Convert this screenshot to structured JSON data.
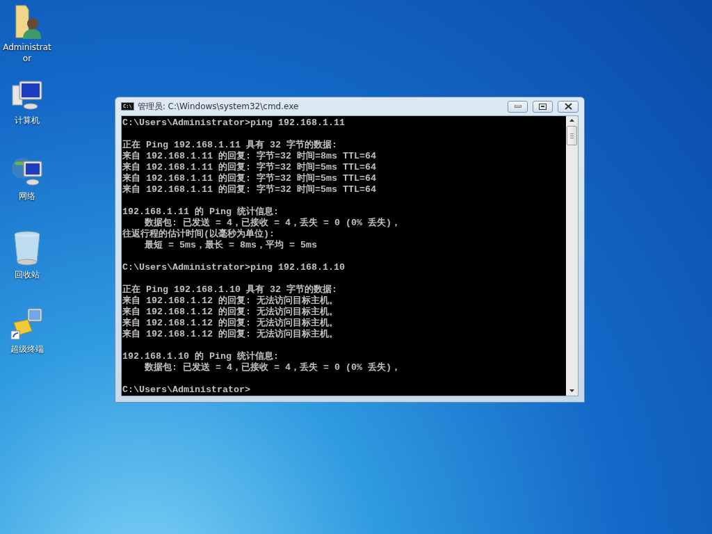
{
  "desktop_icons": [
    {
      "kind": "user-folder",
      "label": "Administrator"
    },
    {
      "kind": "computer",
      "label": "计算机"
    },
    {
      "kind": "network",
      "label": "网络"
    },
    {
      "kind": "recycle-bin",
      "label": "回收站"
    },
    {
      "kind": "terminal-shortcut",
      "label": "超级终端"
    }
  ],
  "window": {
    "title": "管理员: C:\\Windows\\system32\\cmd.exe",
    "icon_text": "C:\\",
    "console_blocks": [
      {
        "lines": [
          "C:\\Users\\Administrator>ping 192.168.1.11"
        ]
      },
      {
        "lines": [
          "正在 Ping 192.168.1.11 具有 32 字节的数据:",
          "来自 192.168.1.11 的回复: 字节=32 时间=8ms TTL=64",
          "来自 192.168.1.11 的回复: 字节=32 时间=5ms TTL=64",
          "来自 192.168.1.11 的回复: 字节=32 时间=5ms TTL=64",
          "来自 192.168.1.11 的回复: 字节=32 时间=5ms TTL=64"
        ]
      },
      {
        "lines": [
          "192.168.1.11 的 Ping 统计信息:",
          "    数据包: 已发送 = 4，已接收 = 4，丢失 = 0 (0% 丢失)，",
          "往返行程的估计时间(以毫秒为单位):",
          "    最短 = 5ms，最长 = 8ms，平均 = 5ms"
        ]
      },
      {
        "lines": [
          "C:\\Users\\Administrator>ping 192.168.1.10"
        ]
      },
      {
        "lines": [
          "正在 Ping 192.168.1.10 具有 32 字节的数据:",
          "来自 192.168.1.12 的回复: 无法访问目标主机。",
          "来自 192.168.1.12 的回复: 无法访问目标主机。",
          "来自 192.168.1.12 的回复: 无法访问目标主机。",
          "来自 192.168.1.12 的回复: 无法访问目标主机。"
        ]
      },
      {
        "lines": [
          "192.168.1.10 的 Ping 统计信息:",
          "    数据包: 已发送 = 4，已接收 = 4，丢失 = 0 (0% 丢失)，"
        ]
      },
      {
        "lines": [
          "C:\\Users\\Administrator>"
        ]
      }
    ]
  }
}
